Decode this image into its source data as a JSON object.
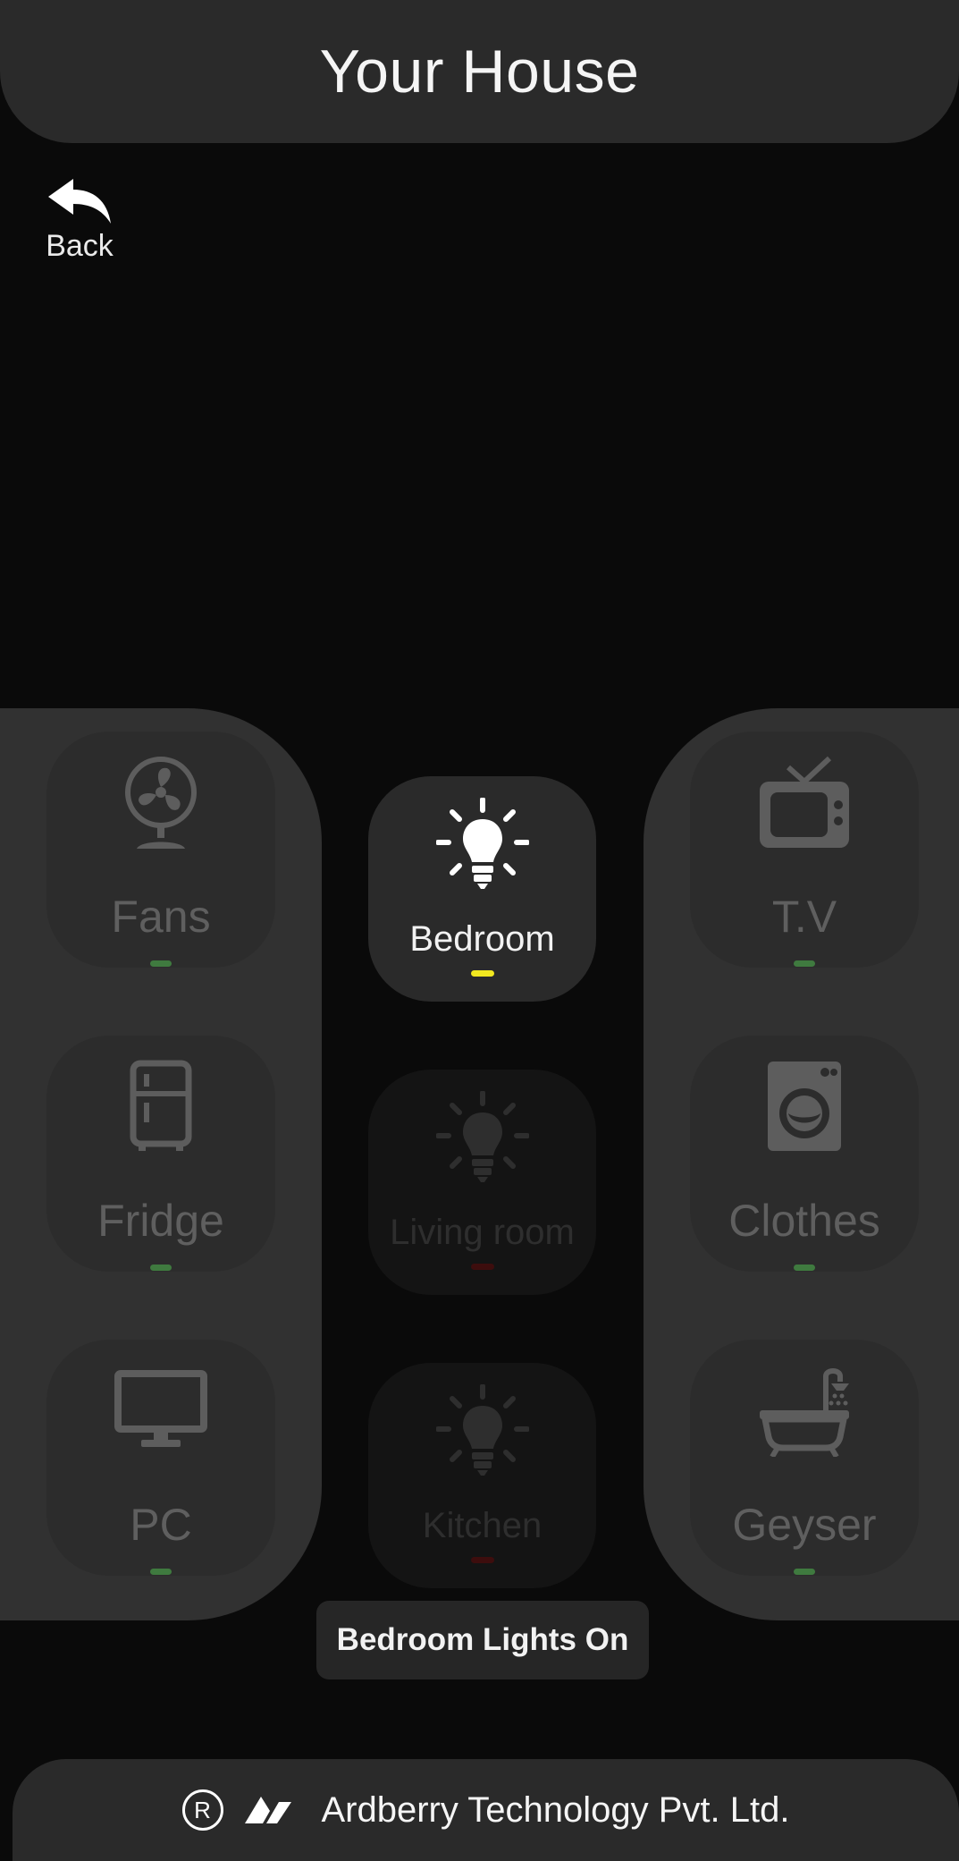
{
  "header": {
    "title": "Your House"
  },
  "back": {
    "label": "Back"
  },
  "appliances_left": [
    {
      "label": "Fans",
      "icon": "fan-icon",
      "status": "on"
    },
    {
      "label": "Fridge",
      "icon": "fridge-icon",
      "status": "on"
    },
    {
      "label": "PC",
      "icon": "monitor-icon",
      "status": "on"
    }
  ],
  "appliances_right": [
    {
      "label": "T.V",
      "icon": "tv-icon",
      "status": "on"
    },
    {
      "label": "Clothes",
      "icon": "washing-machine-icon",
      "status": "on"
    },
    {
      "label": "Geyser",
      "icon": "bathtub-icon",
      "status": "on"
    }
  ],
  "rooms": [
    {
      "label": "Bedroom",
      "icon": "bulb-icon",
      "active": true
    },
    {
      "label": "Living room",
      "icon": "bulb-icon",
      "active": false
    },
    {
      "label": "Kitchen",
      "icon": "bulb-icon",
      "active": false
    }
  ],
  "toast": {
    "message": "Bedroom Lights On"
  },
  "footer": {
    "company": "Ardberry Technology Pvt. Ltd."
  },
  "colors": {
    "active_indicator": "#f2e820",
    "on_indicator": "#3f7a3f",
    "off_indicator": "#3d0d0d"
  }
}
